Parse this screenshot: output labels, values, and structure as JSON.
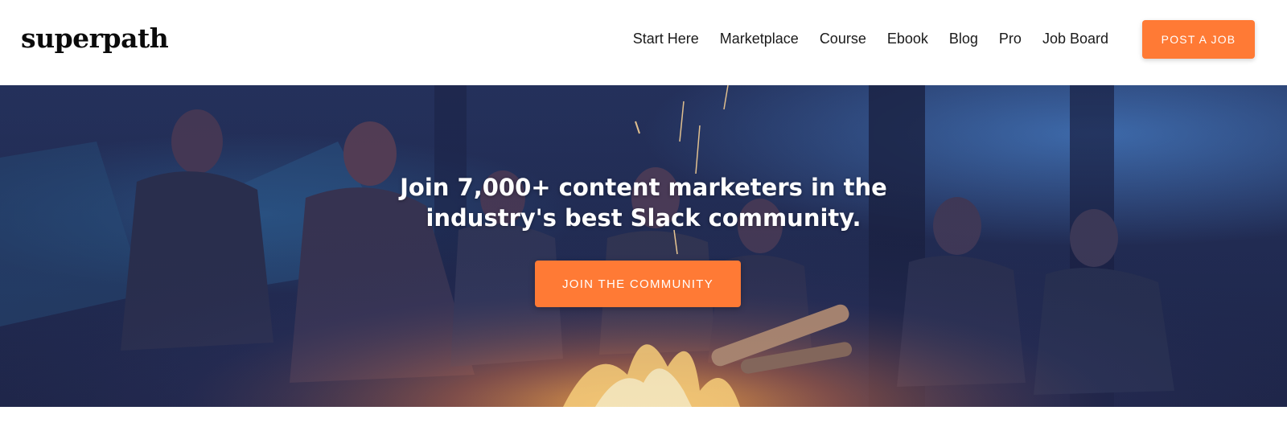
{
  "brand": {
    "logo_text": "superpath",
    "accent_color": "#ff7a35"
  },
  "nav": {
    "items": [
      {
        "label": "Start Here"
      },
      {
        "label": "Marketplace"
      },
      {
        "label": "Course"
      },
      {
        "label": "Ebook"
      },
      {
        "label": "Blog"
      },
      {
        "label": "Pro"
      },
      {
        "label": "Job Board"
      }
    ],
    "cta_label": "POST A JOB"
  },
  "hero": {
    "title_line1": "Join 7,000+ content marketers in the",
    "title_line2": "industry's best Slack community.",
    "cta_label": "JOIN THE COMMUNITY",
    "image_subject": "people-around-campfire-photo"
  }
}
